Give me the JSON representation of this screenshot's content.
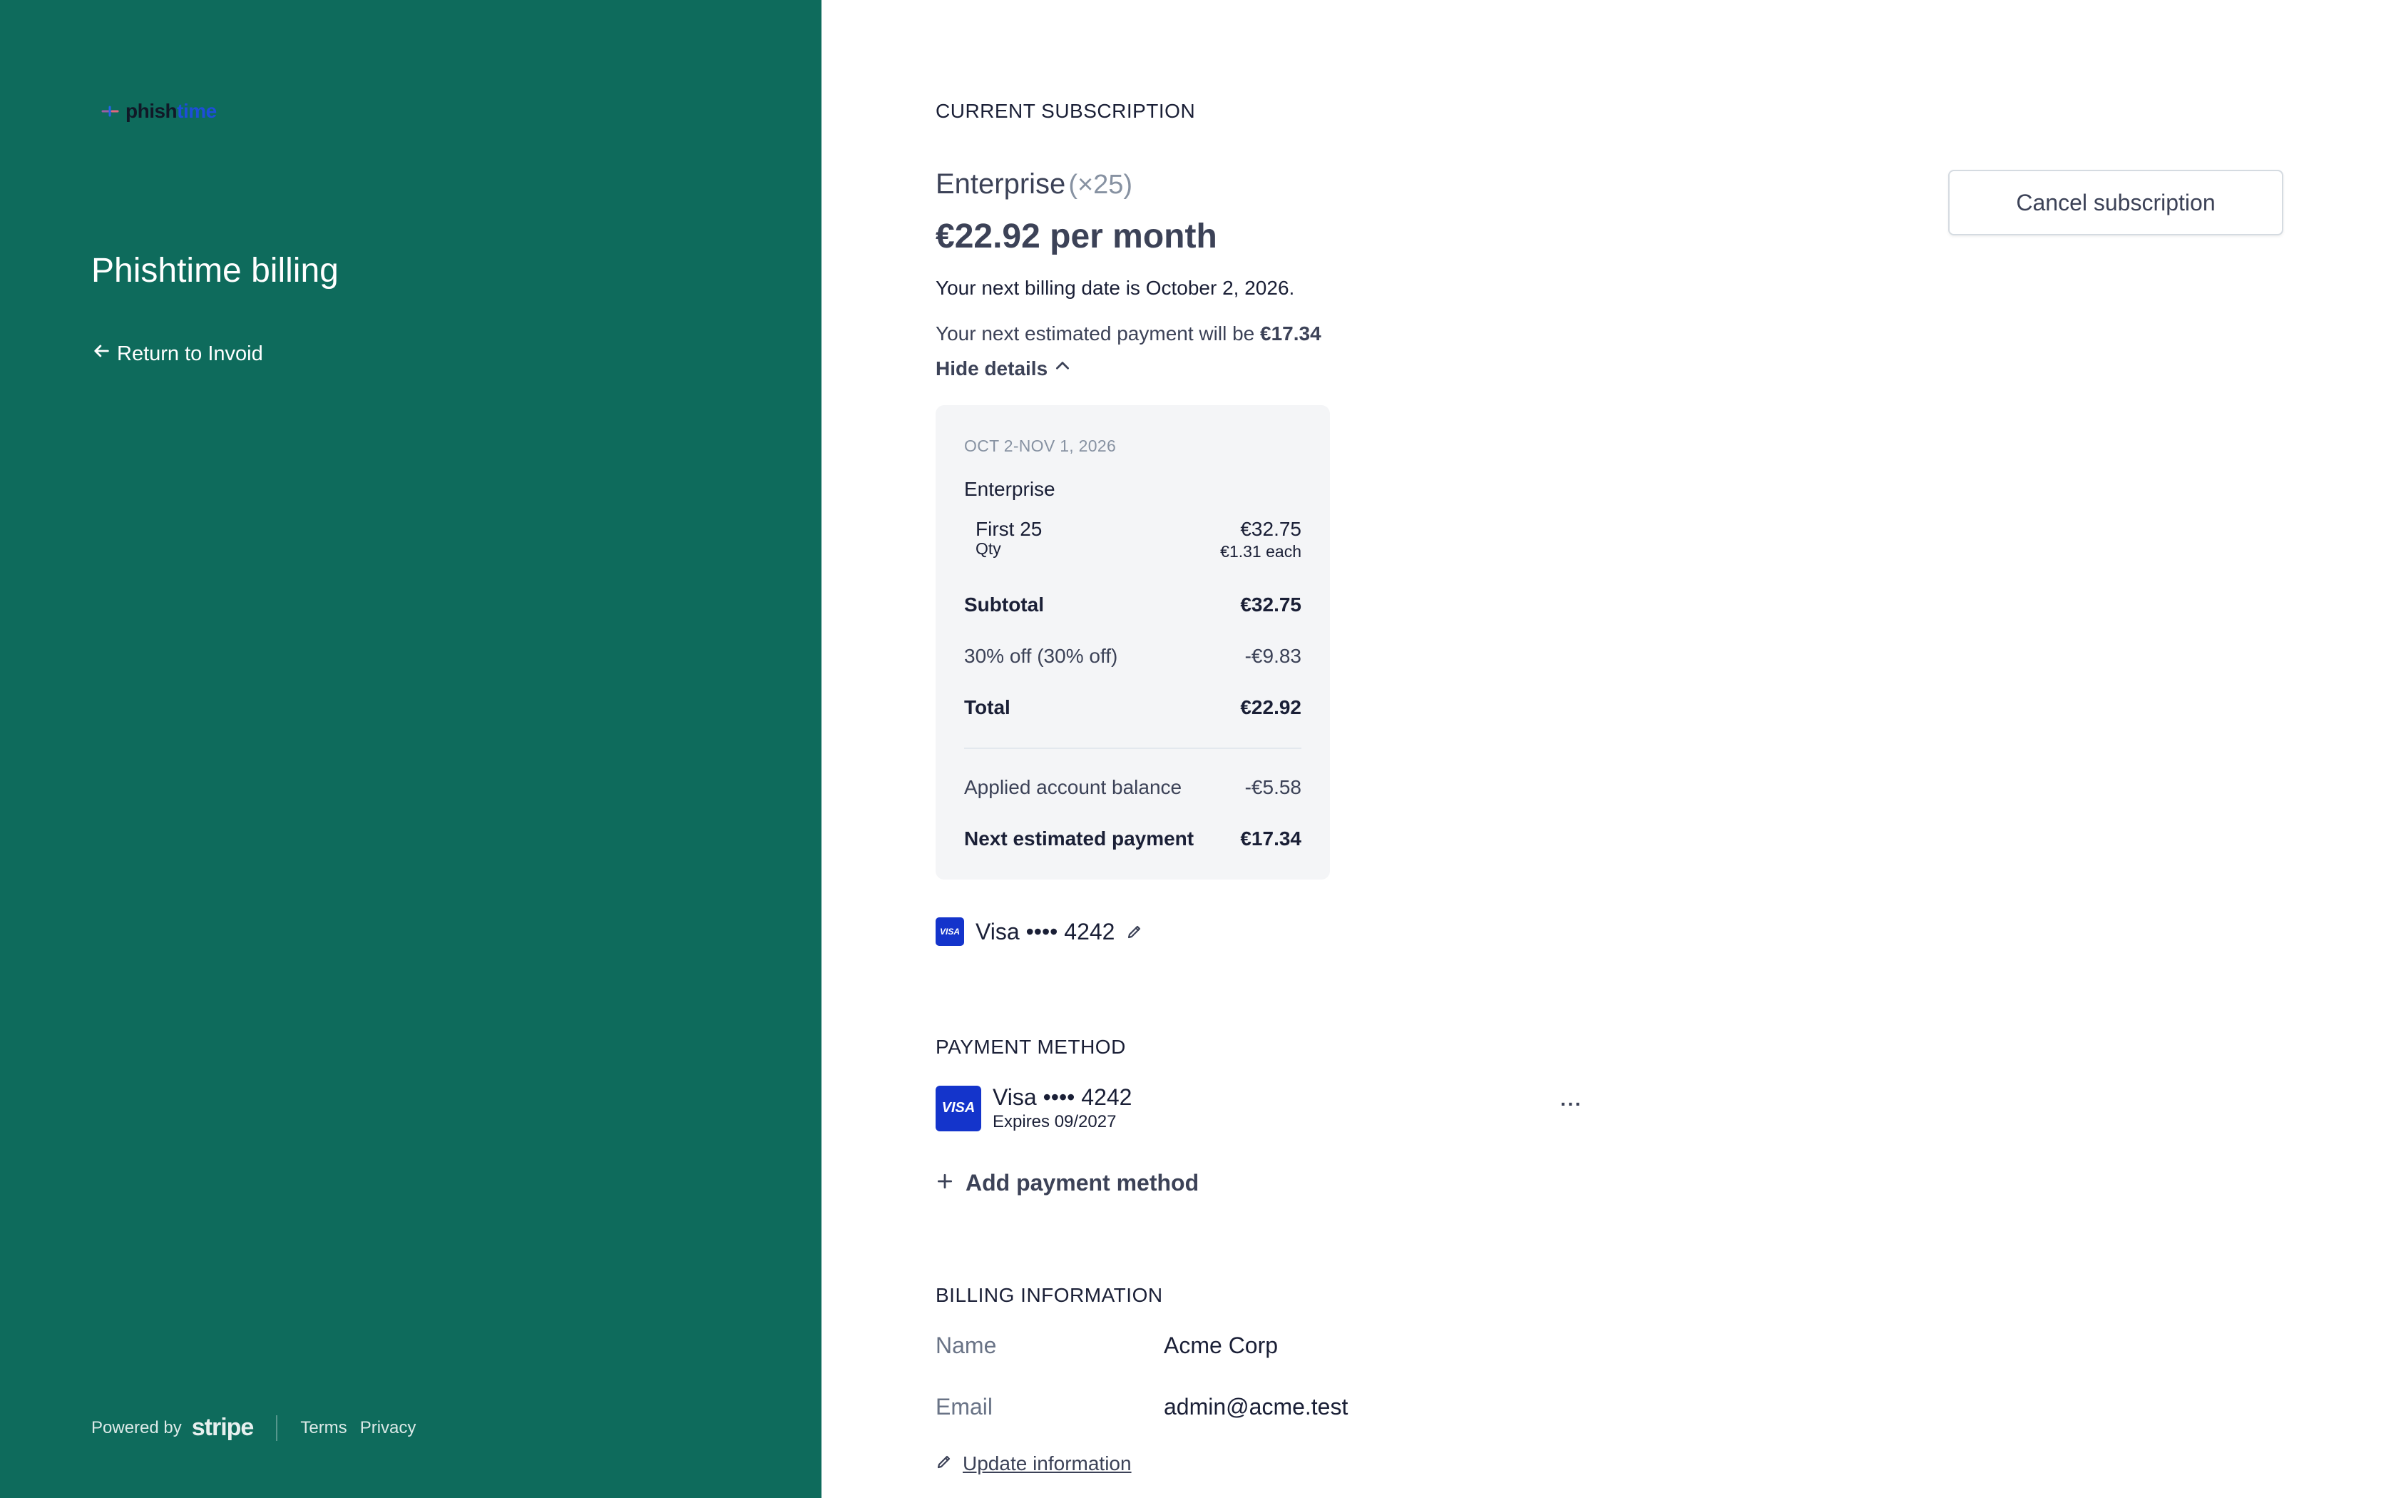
{
  "brand": {
    "logo_text_a": "phish",
    "logo_text_b": "time",
    "logo_icon": "fish-hook-icon",
    "sidebar_color": "#0e6b5c"
  },
  "sidebar": {
    "title": "Phishtime billing",
    "return_label": "Return to Invoid",
    "return_icon": "arrow-left-icon",
    "footer": {
      "powered_by": "Powered by",
      "stripe": "stripe",
      "terms": "Terms",
      "privacy": "Privacy"
    }
  },
  "subscription": {
    "section_label": "CURRENT SUBSCRIPTION",
    "plan_name": "Enterprise",
    "plan_qty": "(×25)",
    "price": "€22.92 per month",
    "next_billing": "Your next billing date is October 2, 2026.",
    "next_payment_prefix": "Your next estimated payment will be ",
    "next_payment_amount": "€17.34",
    "hide_details": "Hide details",
    "cancel_label": "Cancel subscription",
    "details": {
      "period": "OCT 2-NOV 1, 2026",
      "product": "Enterprise",
      "tier_label": "First 25",
      "tier_sub": "Qty",
      "tier_amount": "€32.75",
      "tier_each": "€1.31 each",
      "subtotal_label": "Subtotal",
      "subtotal_value": "€32.75",
      "discount_label": "30% off (30% off)",
      "discount_value": "-€9.83",
      "total_label": "Total",
      "total_value": "€22.92",
      "balance_label": "Applied account balance",
      "balance_value": "-€5.58",
      "next_label": "Next estimated payment",
      "next_value": "€17.34"
    },
    "card": {
      "brand": "VISA",
      "label": "Visa •••• 4242"
    }
  },
  "payment_method": {
    "section_label": "PAYMENT METHOD",
    "card_brand": "VISA",
    "card_label": "Visa •••• 4242",
    "expires": "Expires 09/2027",
    "more": "···",
    "add_label": "Add payment method"
  },
  "billing_info": {
    "section_label": "BILLING INFORMATION",
    "name_label": "Name",
    "name_value": "Acme Corp",
    "email_label": "Email",
    "email_value": "admin@acme.test",
    "update_label": "Update information"
  },
  "colors": {
    "visa_blue": "#1434cb",
    "details_bg": "#f4f5f7"
  }
}
